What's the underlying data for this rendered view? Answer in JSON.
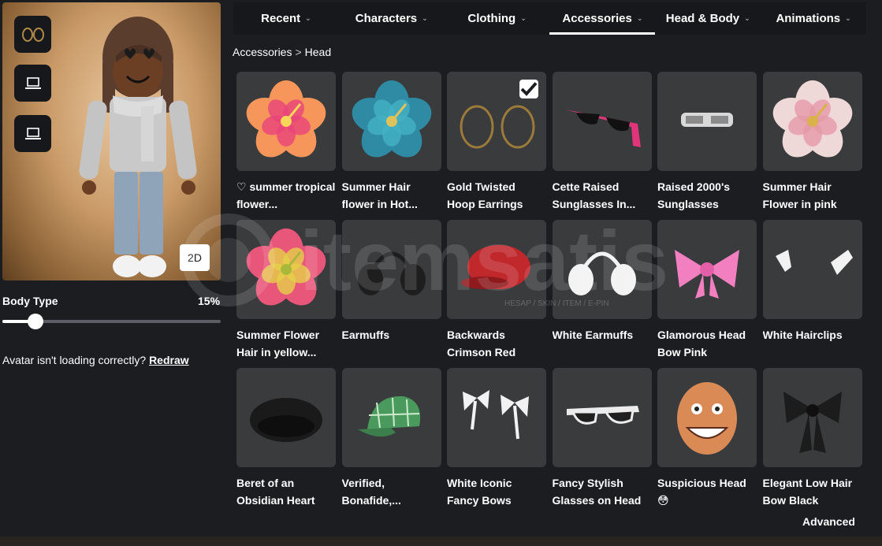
{
  "tabs": [
    {
      "label": "Recent",
      "active": false
    },
    {
      "label": "Characters",
      "active": false
    },
    {
      "label": "Clothing",
      "active": false
    },
    {
      "label": "Accessories",
      "active": true
    },
    {
      "label": "Head & Body",
      "active": false
    },
    {
      "label": "Animations",
      "active": false
    }
  ],
  "breadcrumb": {
    "parent": "Accessories",
    "separator": ">",
    "current": "Head"
  },
  "preview": {
    "side_buttons": [
      "hoop-earrings-icon",
      "laptop-icon",
      "laptop-icon"
    ],
    "toggle_2d": "2D"
  },
  "body_type": {
    "label": "Body Type",
    "value": "15%",
    "fraction": 0.15
  },
  "redraw": {
    "text": "Avatar isn't loading correctly?",
    "link": "Redraw"
  },
  "items": [
    {
      "name": "♡ summer tropical flower...",
      "icon": "pink-hibiscus-icon",
      "selected": false
    },
    {
      "name": "Summer Hair flower in Hot...",
      "icon": "blue-hibiscus-icon",
      "selected": false
    },
    {
      "name": "Gold Twisted Hoop Earrings",
      "icon": "gold-hoop-earrings-icon",
      "selected": true
    },
    {
      "name": "Cette Raised Sunglasses In...",
      "icon": "pink-sunglasses-icon",
      "selected": false
    },
    {
      "name": "Raised 2000's Sunglasses",
      "icon": "silver-sunglasses-icon",
      "selected": false
    },
    {
      "name": "Summer Hair Flower in pink",
      "icon": "pink-white-hibiscus-icon",
      "selected": false
    },
    {
      "name": "Summer Flower Hair in yellow...",
      "icon": "yellow-pink-hibiscus-icon",
      "selected": false
    },
    {
      "name": "Earmuffs",
      "icon": "black-earmuffs-icon",
      "selected": false
    },
    {
      "name": "Backwards Crimson Red",
      "icon": "red-cap-icon",
      "selected": false
    },
    {
      "name": "White Earmuffs",
      "icon": "white-earmuffs-icon",
      "selected": false
    },
    {
      "name": "Glamorous Head Bow Pink",
      "icon": "pink-bow-icon",
      "selected": false
    },
    {
      "name": "White Hairclips",
      "icon": "white-hairclips-icon",
      "selected": false
    },
    {
      "name": "Beret of an Obsidian Heart",
      "icon": "black-beret-icon",
      "selected": false
    },
    {
      "name": "Verified, Bonafide,...",
      "icon": "green-plaid-cap-icon",
      "selected": false
    },
    {
      "name": "White Iconic Fancy Bows",
      "icon": "white-bows-icon",
      "selected": false
    },
    {
      "name": "Fancy Stylish Glasses on Head",
      "icon": "white-glasses-icon",
      "selected": false
    },
    {
      "name": "Suspicious Head 😳",
      "icon": "grinning-head-icon",
      "selected": false
    },
    {
      "name": "Elegant Low Hair Bow Black",
      "icon": "black-bow-icon",
      "selected": false
    }
  ],
  "advanced_label": "Advanced",
  "watermark": {
    "text": "itemsatis",
    "subtext": "HESAP / SKIN / ITEM / E-PIN"
  },
  "colors": {
    "background": "#1b1d21",
    "tile": "#393b3d",
    "tabbar": "#17181b",
    "accent": "#ffffff"
  }
}
